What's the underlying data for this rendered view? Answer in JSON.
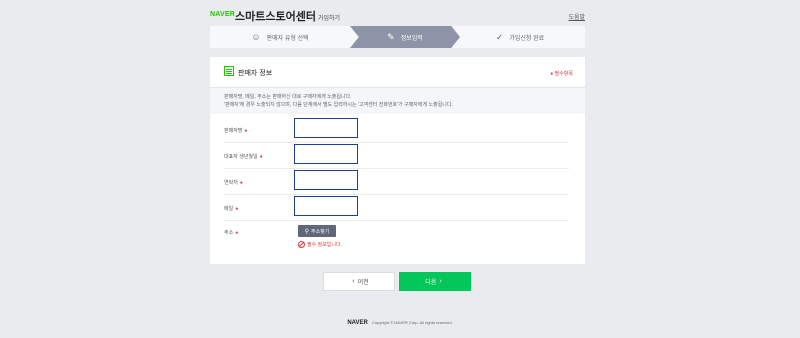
{
  "header": {
    "logo": "NAVER",
    "title": "스마트스토어센터",
    "subtitle": "가입하기",
    "help_link": "도움말"
  },
  "steps": [
    {
      "label": "판매자 유형 선택",
      "icon": "users-icon",
      "active": false
    },
    {
      "label": "정보입력",
      "icon": "pencil-icon",
      "active": true
    },
    {
      "label": "가입신청 완료",
      "icon": "check-icon",
      "active": false
    }
  ],
  "card": {
    "title": "판매자 정보",
    "required_note": "● 필수항목",
    "notice_lines": [
      "판매자명, 메일, 주소는 판매하신 대로 구매자에게 노출됩니다.",
      "'판매자'에 경우 노출되지 않으며, 다음 단계에서 별도 입력하시는 '고객센터 전화번호'가 구매자에게 노출됩니다."
    ],
    "fields": [
      {
        "label": "판매자명",
        "value": ""
      },
      {
        "label": "대표자 생년월일",
        "value": ""
      },
      {
        "label": "연락처",
        "value": ""
      },
      {
        "label": "메일",
        "value": ""
      }
    ],
    "address": {
      "label": "주소",
      "button": "주소찾기",
      "error": "필수 정보입니다."
    }
  },
  "buttons": {
    "prev": "이전",
    "next": "다음"
  },
  "footer": {
    "logo": "NAVER",
    "copyright": "Copyright © NAVER Corp. All rights reserved."
  },
  "colors": {
    "brand_green": "#1ec800",
    "next_button": "#03c75a",
    "active_step": "#8d94a7",
    "required": "#e0383e",
    "input_border": "#1f3f8c"
  }
}
